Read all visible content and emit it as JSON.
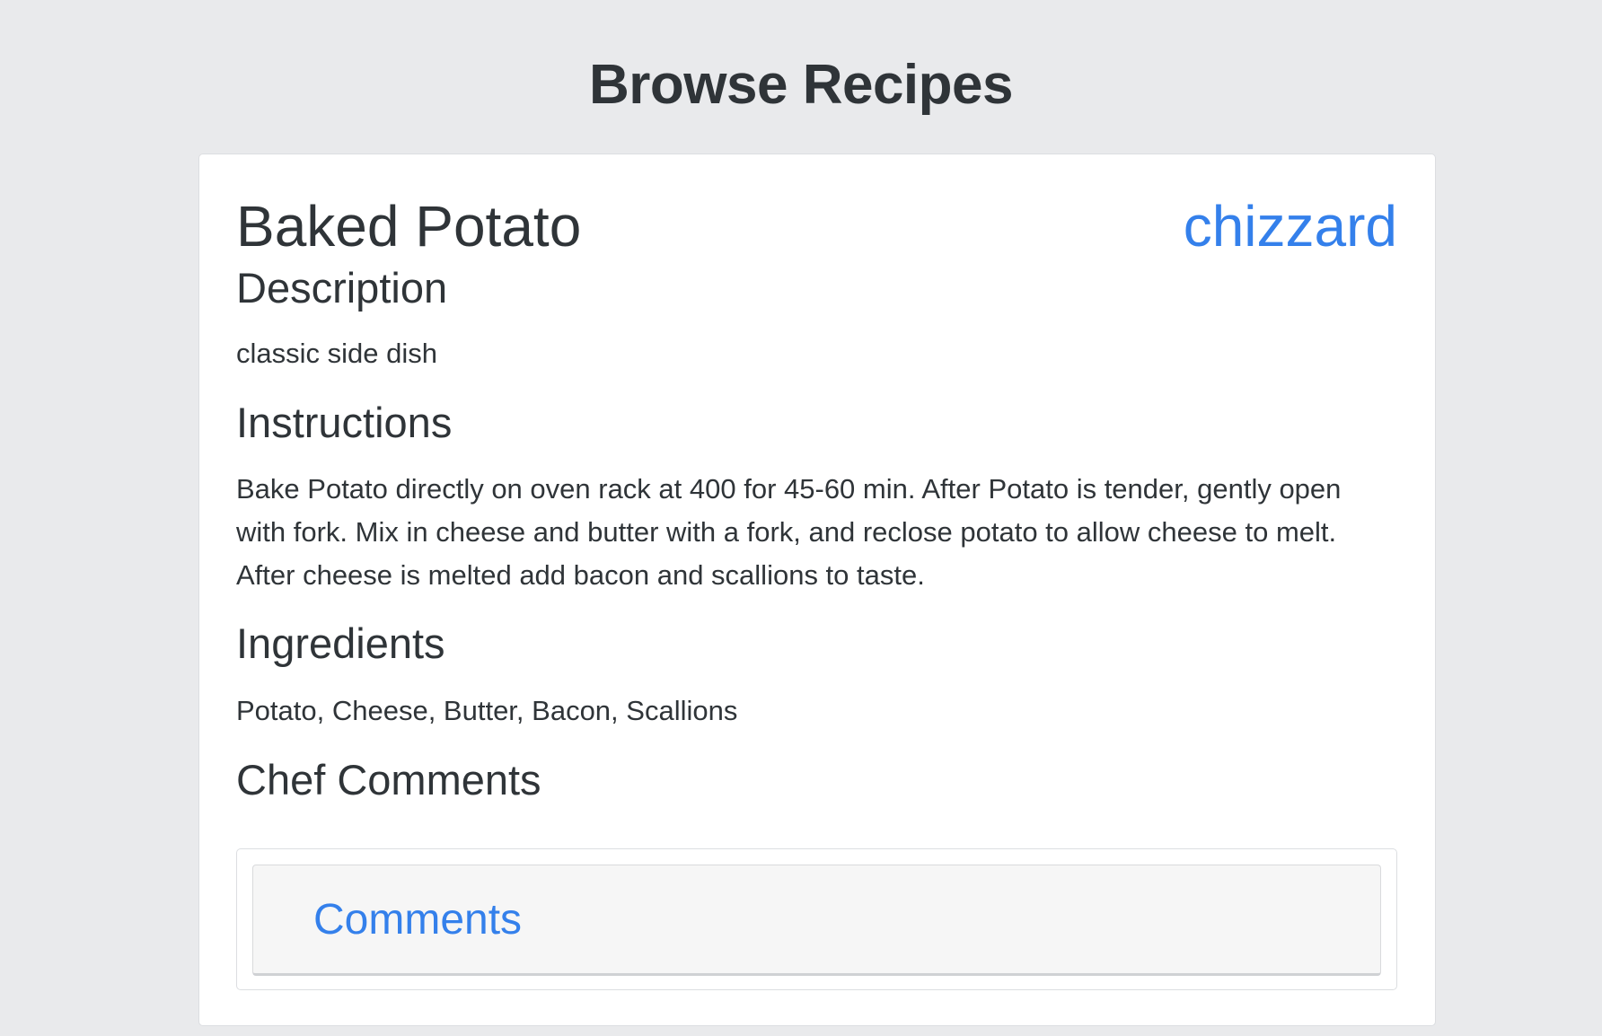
{
  "page": {
    "title": "Browse Recipes"
  },
  "recipe": {
    "name": "Baked Potato",
    "author": "chizzard",
    "description_heading": "Description",
    "description": "classic side dish",
    "instructions_heading": "Instructions",
    "instructions": "Bake Potato directly on oven rack at 400 for 45-60 min. After Potato is tender, gently open with fork. Mix in cheese and butter with a fork, and reclose potato to allow cheese to melt. After cheese is melted add bacon and scallions to taste.",
    "ingredients_heading": "Ingredients",
    "ingredients": "Potato, Cheese, Butter, Bacon, Scallions",
    "chef_comments_heading": "Chef Comments",
    "comments_label": "Comments"
  },
  "colors": {
    "page_background": "#e9eaec",
    "card_background": "#ffffff",
    "text": "#2f3438",
    "link": "#3480eb",
    "comments_header_background": "#f6f6f6"
  }
}
